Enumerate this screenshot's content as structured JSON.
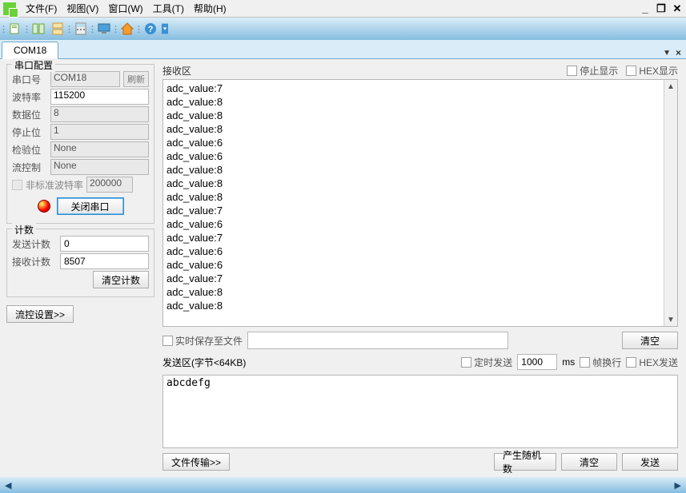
{
  "menu": {
    "file": "文件(F)",
    "view": "视图(V)",
    "window": "窗口(W)",
    "tools": "工具(T)",
    "help": "帮助(H)"
  },
  "winctrl": {
    "min": "_",
    "restore": "❐",
    "close": "✕"
  },
  "tab": {
    "active": "COM18",
    "dropdown": "▼",
    "close": "×"
  },
  "port": {
    "legend": "串口配置",
    "port_label": "串口号",
    "port_value": "COM18",
    "refresh": "刷新",
    "baud_label": "波特率",
    "baud_value": "115200",
    "data_label": "数据位",
    "data_value": "8",
    "stop_label": "停止位",
    "stop_value": "1",
    "parity_label": "检验位",
    "parity_value": "None",
    "flow_label": "流控制",
    "flow_value": "None",
    "nonstd_label": "非标准波特率",
    "nonstd_value": "200000",
    "close_btn": "关闭串口"
  },
  "count": {
    "legend": "计数",
    "send_label": "发送计数",
    "send_value": "0",
    "recv_label": "接收计数",
    "recv_value": "8507",
    "clear_btn": "清空计数"
  },
  "flow_settings_btn": "流控设置>>",
  "rx": {
    "title": "接收区",
    "stop_display": "停止显示",
    "hex_display": "HEX显示",
    "lines": [
      "adc_value:7",
      "adc_value:8",
      "adc_value:8",
      "adc_value:8",
      "adc_value:6",
      "adc_value:6",
      "adc_value:8",
      "adc_value:8",
      "adc_value:8",
      "adc_value:7",
      "adc_value:6",
      "adc_value:7",
      "adc_value:6",
      "adc_value:6",
      "adc_value:7",
      "adc_value:8",
      "adc_value:8"
    ]
  },
  "savefile": {
    "chk_label": "实时保存至文件",
    "clear_btn": "清空"
  },
  "tx": {
    "title": "发送区(字节<64KB)",
    "timed_label": "定时发送",
    "timed_value": "1000",
    "timed_unit": "ms",
    "wrap_label": "帧换行",
    "hex_label": "HEX发送",
    "content": "abcdefg",
    "file_btn": "文件传输>>",
    "random_btn": "产生随机数",
    "clear_btn": "清空",
    "send_btn": "发送"
  },
  "footer": {
    "left": "◀",
    "right": "▶"
  }
}
